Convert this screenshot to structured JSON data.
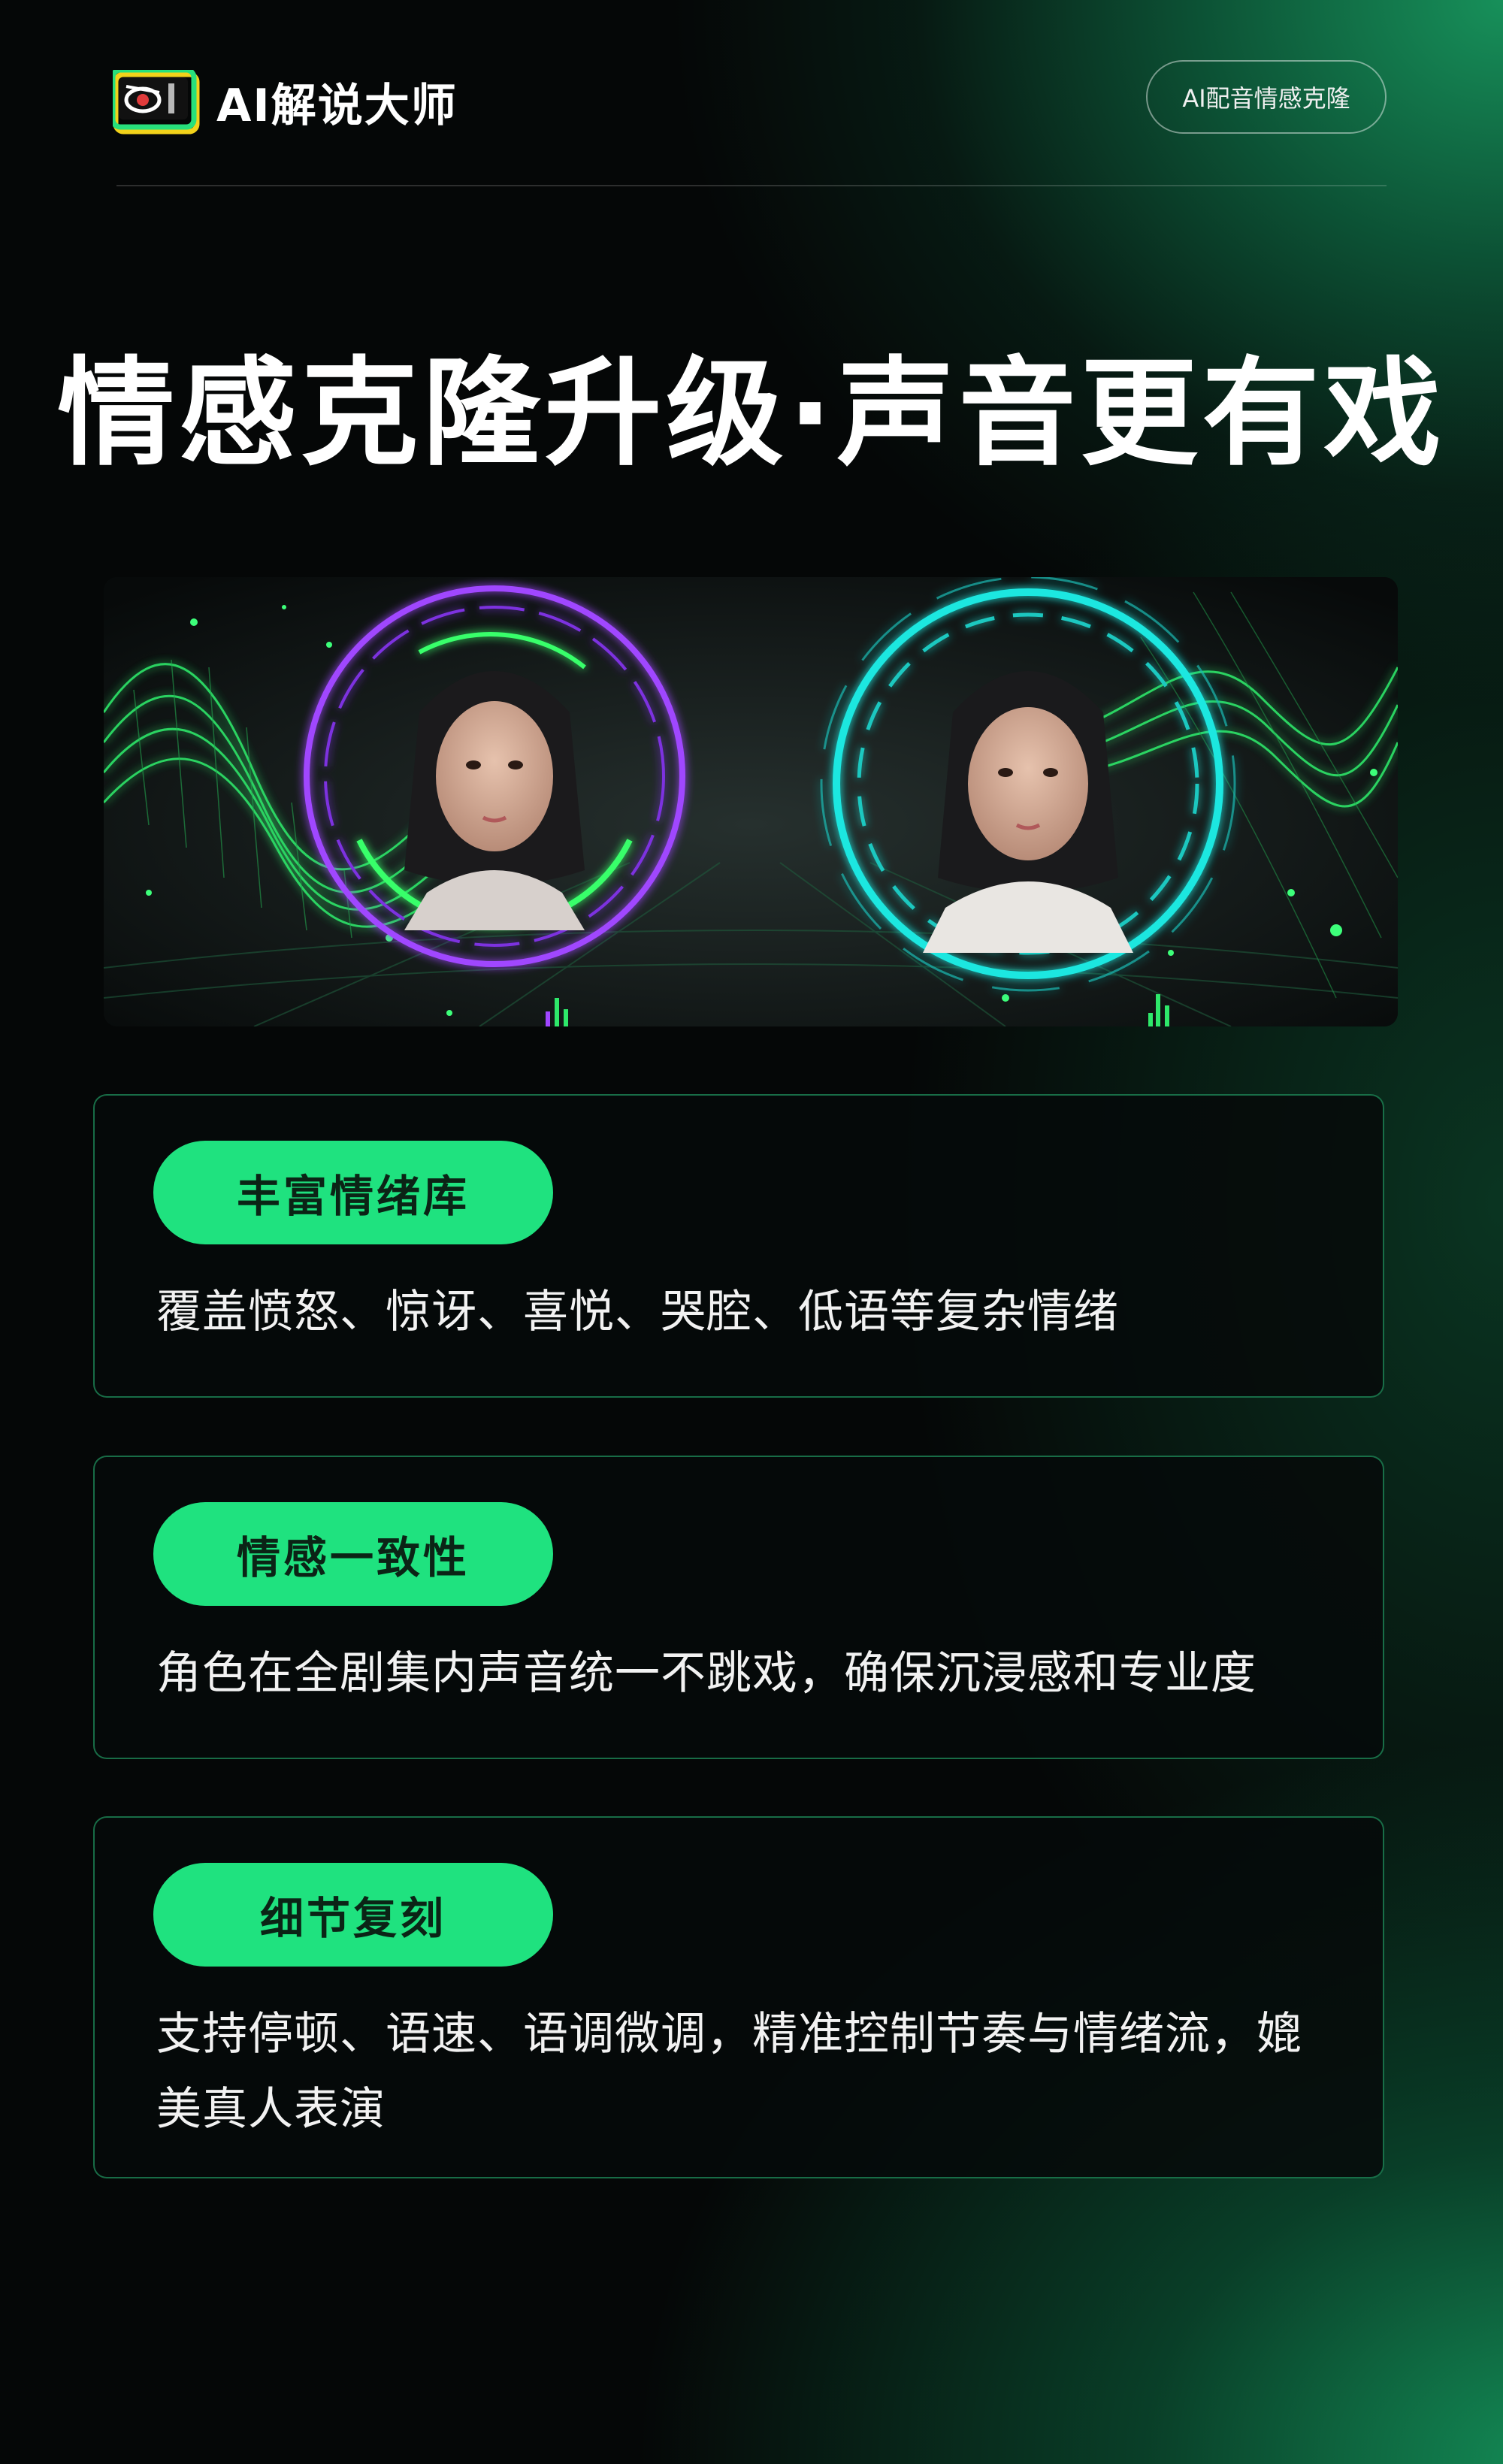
{
  "brand": {
    "name": "AI解说大师"
  },
  "header": {
    "badge": "AI配音情感克隆"
  },
  "headline": "情感克隆升级·声音更有戏",
  "colors": {
    "accent": "#1fe27f",
    "purple_ring": "#a046ff",
    "cyan_ring": "#1de7e0",
    "background": "#050707"
  },
  "features": [
    {
      "tag": "丰富情绪库",
      "text": "覆盖愤怒、惊讶、喜悦、哭腔、低语等复杂情绪"
    },
    {
      "tag": "情感一致性",
      "text": "角色在全剧集内声音统一不跳戏，确保沉浸感和专业度"
    },
    {
      "tag": "细节复刻",
      "text": "支持停顿、语速、语调微调，精准控制节奏与情绪流，媲美真人表演"
    }
  ]
}
